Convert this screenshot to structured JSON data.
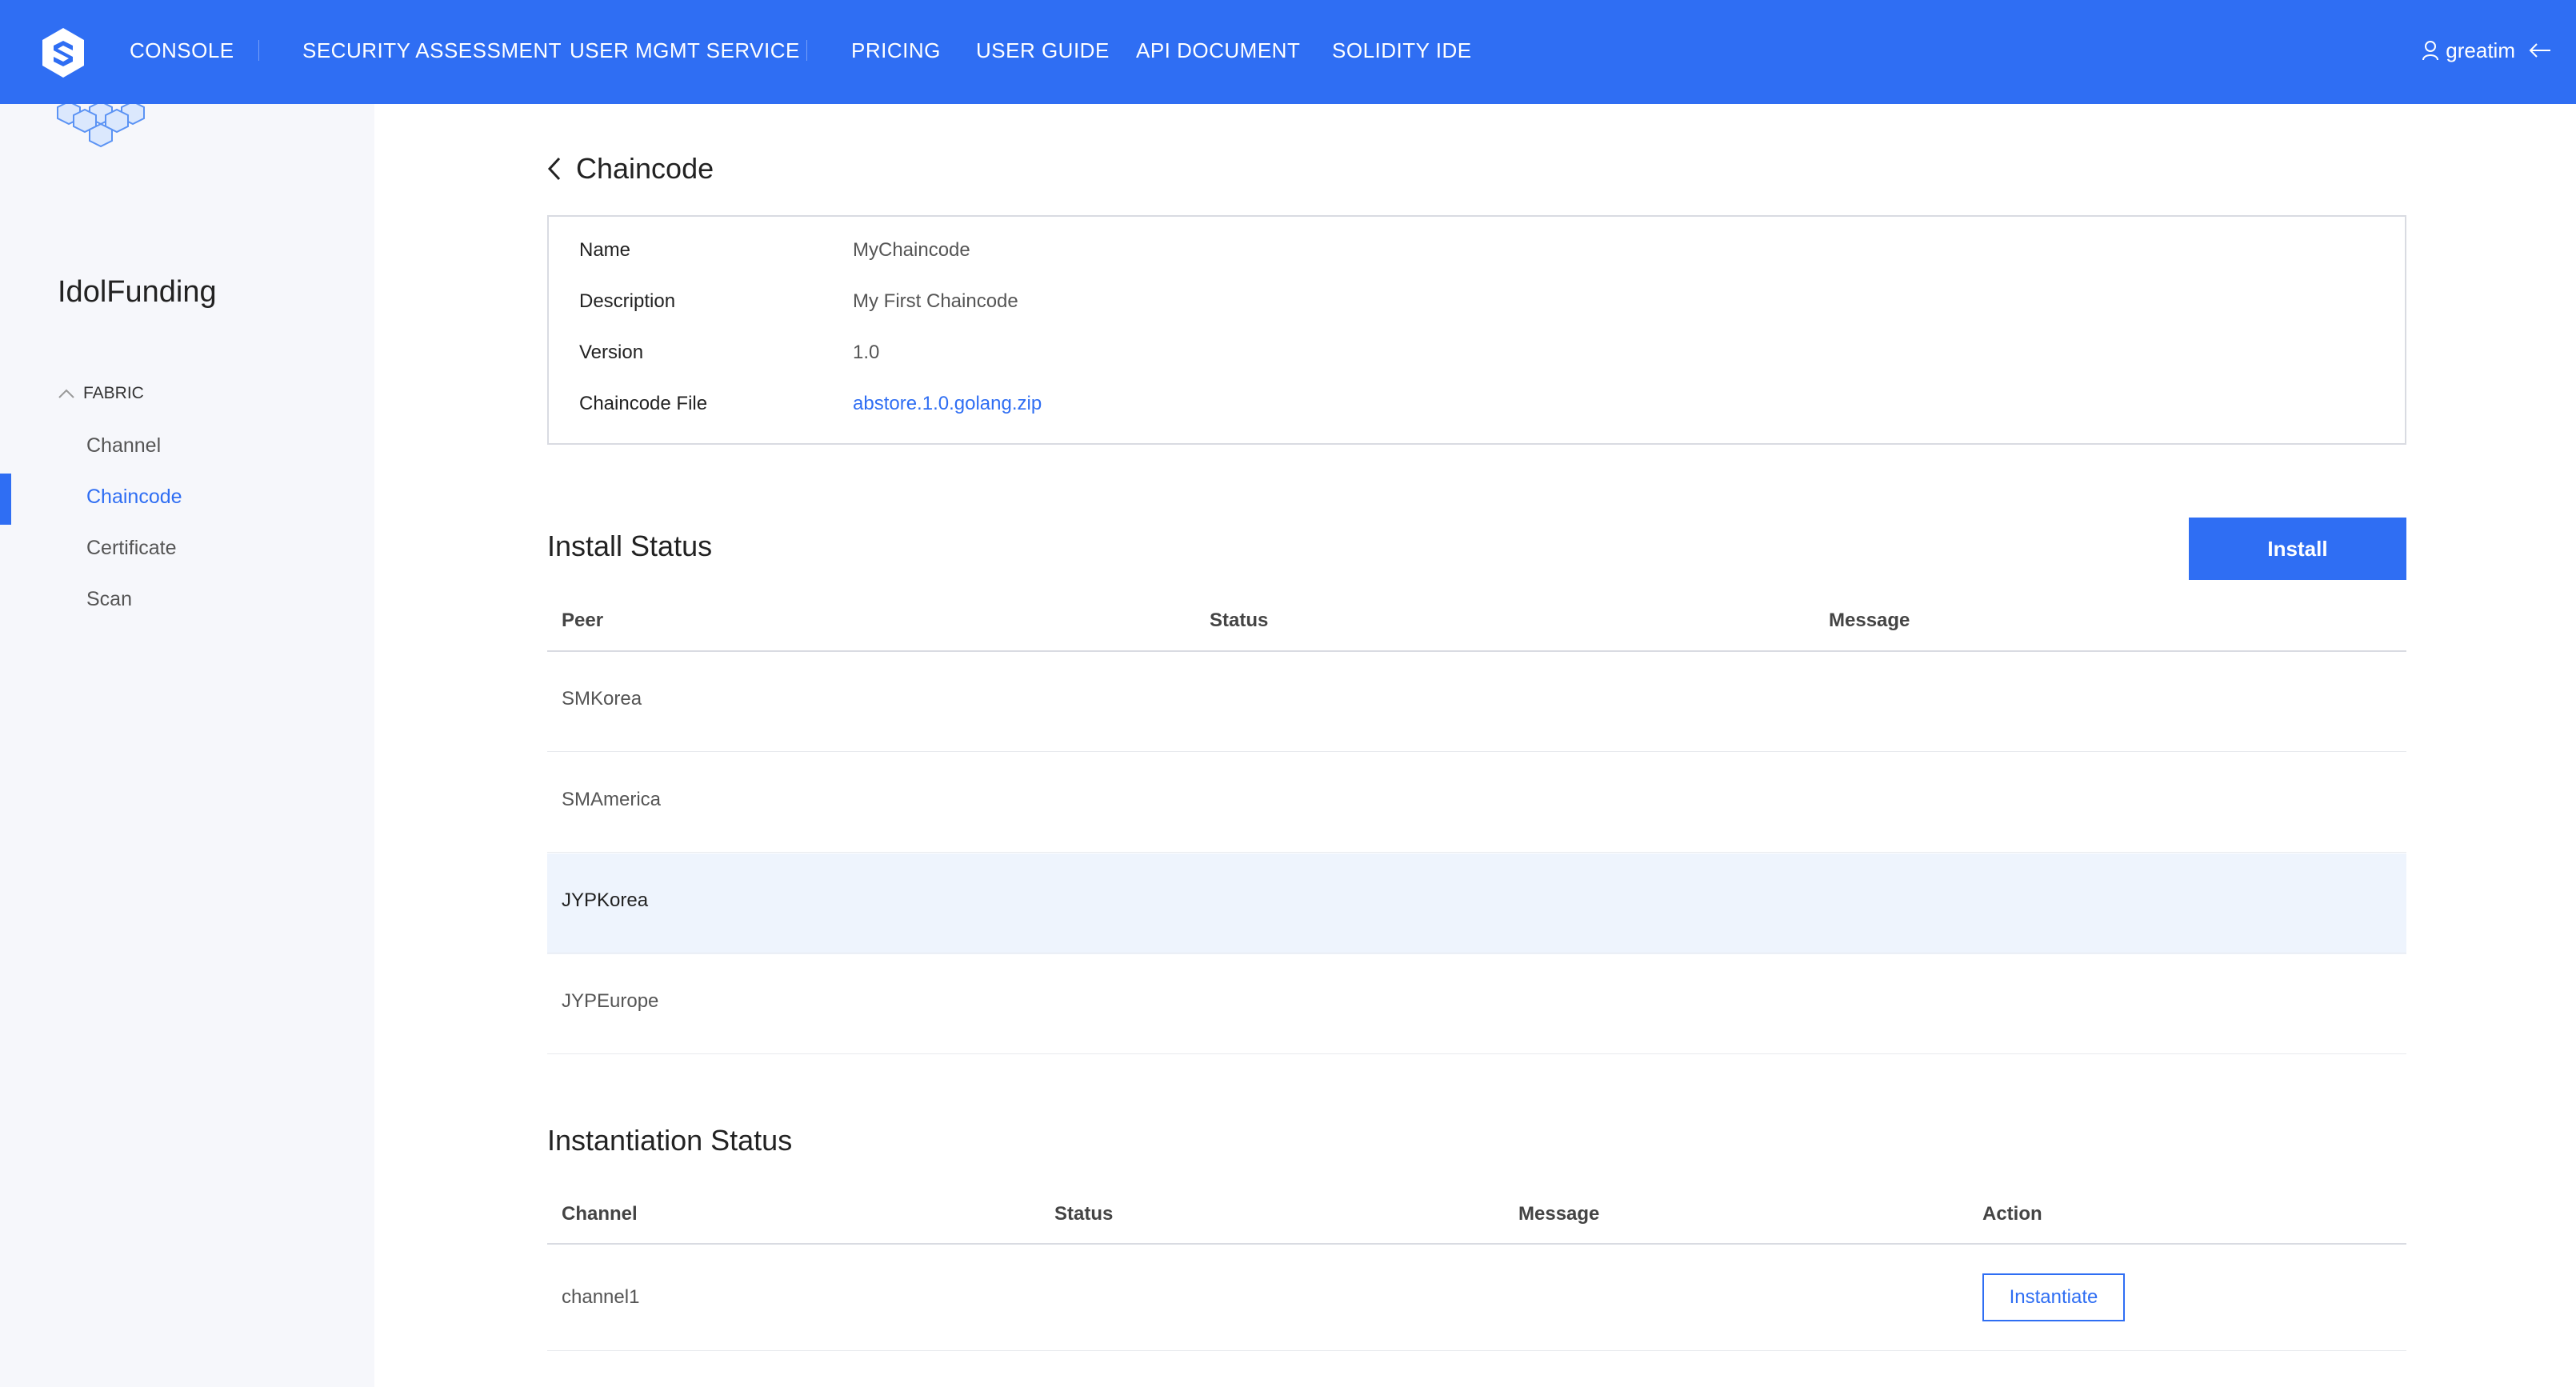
{
  "nav": {
    "items": [
      "CONSOLE",
      "SECURITY ASSESSMENT",
      "USER MGMT SERVICE",
      "PRICING",
      "USER GUIDE",
      "API DOCUMENT",
      "SOLIDITY IDE"
    ],
    "username": "greatim"
  },
  "sidebar": {
    "project_name": "IdolFunding",
    "section": "FABRIC",
    "items": [
      "Channel",
      "Chaincode",
      "Certificate",
      "Scan"
    ],
    "active": "Chaincode"
  },
  "main": {
    "title": "Chaincode",
    "details": [
      {
        "label": "Name",
        "value": "MyChaincode"
      },
      {
        "label": "Description",
        "value": "My First Chaincode"
      },
      {
        "label": "Version",
        "value": "1.0"
      },
      {
        "label": "Chaincode File",
        "value": "abstore.1.0.golang.zip"
      }
    ],
    "install": {
      "title": "Install Status",
      "button": "Install",
      "columns": [
        "Peer",
        "Status",
        "Message"
      ],
      "rows": [
        "SMKorea",
        "SMAmerica",
        "JYPKorea",
        "JYPEurope"
      ]
    },
    "instantiation": {
      "title": "Instantiation Status",
      "columns": [
        "Channel",
        "Status",
        "Message",
        "Action"
      ],
      "rows": [
        {
          "channel": "channel1",
          "action": "Instantiate"
        }
      ]
    }
  },
  "colors": {
    "accent": "#2f6ef3",
    "sidebar_bg": "#f6f7fb",
    "row_highlight": "#eef4fd"
  }
}
